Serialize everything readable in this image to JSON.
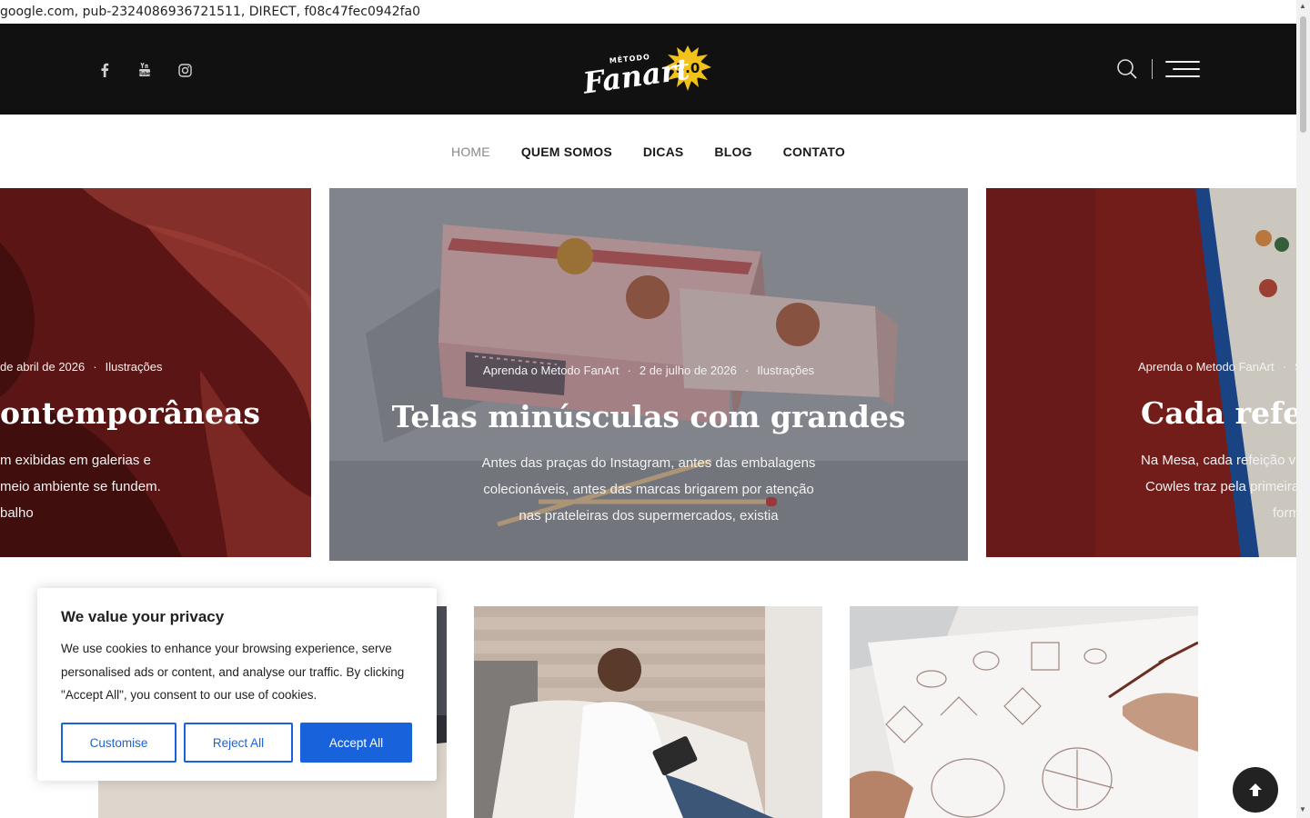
{
  "ads_text": "google.com, pub-2324086936721511, DIRECT, f08c47fec0942fa0",
  "header": {
    "social_icons": [
      "facebook-icon",
      "youtube-icon",
      "instagram-icon"
    ],
    "logo": {
      "small_text": "MÉTODO",
      "script_text": "Fanart",
      "badge": "3.0",
      "badge_color": "#f2c21b"
    },
    "search_icon": "search-icon",
    "menu_icon": "hamburger-menu-icon"
  },
  "nav": {
    "items": [
      {
        "label": "HOME",
        "active": true
      },
      {
        "label": "QUEM SOMOS",
        "active": false
      },
      {
        "label": "DICAS",
        "active": false
      },
      {
        "label": "BLOG",
        "active": false
      },
      {
        "label": "CONTATO",
        "active": false
      }
    ]
  },
  "slider": {
    "left": {
      "date": "de abril de 2026",
      "category": "Ilustrações",
      "title": "ontemporâneas",
      "excerpt": [
        "m exibidas em galerias e",
        "meio ambiente se fundem.",
        "balho"
      ]
    },
    "center": {
      "author": "Aprenda o Metodo FanArt",
      "date": "2 de julho de 2026",
      "category": "Ilustrações",
      "title": "Telas minúsculas com grandes",
      "excerpt": [
        "Antes das praças do Instagram, antes das embalagens",
        "colecionáveis, antes das marcas brigarem por atenção",
        "nas prateleiras dos supermercados, existia"
      ]
    },
    "right": {
      "author": "Aprenda o Metodo FanArt",
      "date": "S",
      "title": "Cada refeiçã",
      "excerpt": [
        "Na Mesa, cada refeição v",
        "Cowles traz pela primeira",
        "form"
      ]
    }
  },
  "cookie": {
    "title": "We value your privacy",
    "body": "We use cookies to enhance your browsing experience, serve personalised ads or content, and analyse our traffic. By clicking \"Accept All\", you consent to our use of cookies.",
    "customise": "Customise",
    "reject": "Reject All",
    "accept": "Accept All",
    "accent": "#1863dc"
  },
  "back_to_top_icon": "arrow-up-icon"
}
